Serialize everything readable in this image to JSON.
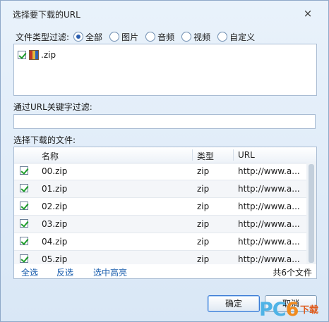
{
  "dialog": {
    "title": "选择要下载的URL",
    "close_symbol": "×"
  },
  "type_filter": {
    "label": "文件类型过滤:",
    "options": [
      {
        "label": "全部",
        "selected": true
      },
      {
        "label": "图片",
        "selected": false
      },
      {
        "label": "音频",
        "selected": false
      },
      {
        "label": "视频",
        "selected": false
      },
      {
        "label": "自定义",
        "selected": false
      }
    ],
    "types": [
      {
        "label": ".zip",
        "checked": true,
        "icon": "archive-icon"
      }
    ]
  },
  "keyword_filter": {
    "label": "通过URL关键字过滤:",
    "value": "",
    "placeholder": ""
  },
  "files": {
    "label": "选择下载的文件:",
    "columns": {
      "name": "名称",
      "type": "类型",
      "url": "URL"
    },
    "rows": [
      {
        "name": "00.zip",
        "type": "zip",
        "url": "http://www.a...",
        "checked": true
      },
      {
        "name": "01.zip",
        "type": "zip",
        "url": "http://www.a...",
        "checked": true
      },
      {
        "name": "02.zip",
        "type": "zip",
        "url": "http://www.a...",
        "checked": true
      },
      {
        "name": "03.zip",
        "type": "zip",
        "url": "http://www.a...",
        "checked": true
      },
      {
        "name": "04.zip",
        "type": "zip",
        "url": "http://www.a...",
        "checked": true
      },
      {
        "name": "05.zip",
        "type": "zip",
        "url": "http://www.a...",
        "checked": true
      }
    ],
    "select_all": "全选",
    "invert": "反选",
    "highlight": "选中高亮",
    "total": "共6个文件"
  },
  "buttons": {
    "ok": "确定",
    "cancel": "取消"
  },
  "watermark": {
    "pc": "PC",
    "six": "6",
    "cn": "下载"
  }
}
